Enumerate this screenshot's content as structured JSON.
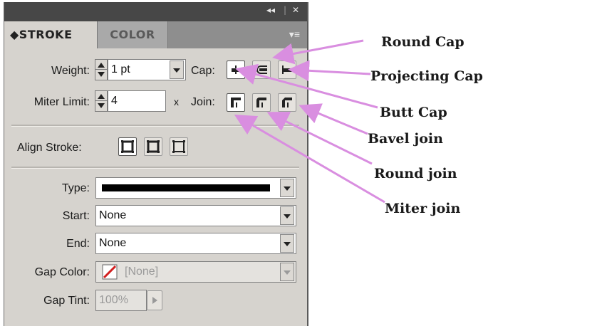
{
  "panel": {
    "titlebar": {
      "collapse_glyph": "◂◂",
      "divider": "|",
      "close_glyph": "✕"
    },
    "tabs": [
      {
        "label": "◆STROKE",
        "active": true
      },
      {
        "label": "COLOR",
        "active": false
      }
    ],
    "menu_glyph": "▾≡",
    "weight": {
      "label": "Weight:",
      "value": "1 pt"
    },
    "cap": {
      "label": "Cap:",
      "options": [
        "butt-cap",
        "round-cap",
        "projecting-cap"
      ],
      "selected": "butt-cap"
    },
    "miter": {
      "label": "Miter Limit:",
      "value": "4",
      "unit": "x"
    },
    "join": {
      "label": "Join:",
      "options": [
        "miter-join",
        "round-join",
        "bevel-join"
      ],
      "selected": "miter-join"
    },
    "align": {
      "label": "Align Stroke:",
      "options": [
        "align-center",
        "align-inside",
        "align-outside"
      ],
      "selected": "align-center"
    },
    "type": {
      "label": "Type:"
    },
    "start": {
      "label": "Start:",
      "value": "None"
    },
    "end": {
      "label": "End:",
      "value": "None"
    },
    "gap_color": {
      "label": "Gap Color:",
      "value": "[None]"
    },
    "gap_tint": {
      "label": "Gap Tint:",
      "value": "100%"
    }
  },
  "annotations": {
    "round_cap": "Round Cap",
    "projecting_cap": "Projecting Cap",
    "butt_cap": "Butt Cap",
    "bevel_join": "Bavel join",
    "round_join": "Round join",
    "miter_join": "Miter join"
  },
  "colors": {
    "arrow": "#d98ee0",
    "panel_bg": "#d6d3ce",
    "titlebar": "#474747",
    "accent_red": "#d21f1f"
  }
}
